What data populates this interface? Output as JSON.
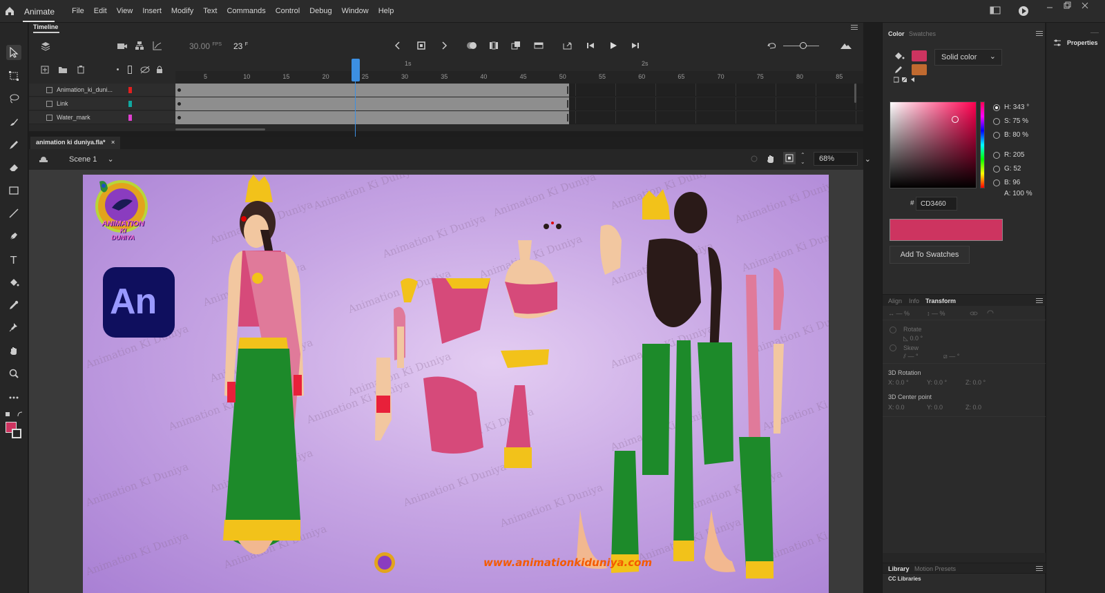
{
  "app": {
    "name": "Animate"
  },
  "menu": [
    "File",
    "Edit",
    "View",
    "Insert",
    "Modify",
    "Text",
    "Commands",
    "Control",
    "Debug",
    "Window",
    "Help"
  ],
  "timeline": {
    "panel_title": "Timeline",
    "fps": "30.00",
    "fps_unit": "FPS",
    "frame": "23",
    "frame_unit": "F",
    "ruler_numbers": [
      "5",
      "10",
      "15",
      "20",
      "25",
      "30",
      "35",
      "40",
      "45",
      "50",
      "55",
      "60",
      "65",
      "70",
      "75",
      "80",
      "85"
    ],
    "ruler_seconds": [
      "1s",
      "2s"
    ],
    "layers": [
      {
        "name": "Animation_ki_duni...",
        "color": "#e02020"
      },
      {
        "name": "Link",
        "color": "#10a8a0"
      },
      {
        "name": "Water_mark",
        "color": "#e040d0"
      }
    ]
  },
  "document": {
    "tab_title": "animation ki duniya.fla*",
    "scene": "Scene 1",
    "zoom": "68%"
  },
  "stage": {
    "logo_text": "An",
    "brand_logo_line1": "ANIMATION",
    "brand_logo_line2": "KI",
    "brand_logo_line3": "DUNIYA",
    "watermark": "Animation Ki Duniya",
    "url": "www.animationkiduniya.com"
  },
  "color_panel": {
    "tabs": [
      "Color",
      "Swatches"
    ],
    "fill_type": "Solid color",
    "stroke_color": "#CD3460",
    "fill_color": "#C06A30",
    "hsb": {
      "H_label": "H:",
      "H": "343 °",
      "S_label": "S:",
      "S": "75 %",
      "B_label": "B:",
      "B": "80 %"
    },
    "rgb": {
      "R_label": "R:",
      "R": "205",
      "G_label": "G:",
      "G": "52",
      "B_label": "B:",
      "B": "96"
    },
    "alpha_label": "A:",
    "alpha": "100 %",
    "hex_prefix": "#",
    "hex": "CD3460",
    "current_color": "#CD3460",
    "add_button": "Add To Swatches"
  },
  "transform_panel": {
    "tabs": [
      "Align",
      "Info",
      "Transform"
    ],
    "width_val": "— %",
    "height_val": "— %",
    "rotate_label": "Rotate",
    "rotate_val": "0.0 °",
    "skew_label": "Skew",
    "skew_val1": "— °",
    "skew_val2": "— °",
    "rot3d_label": "3D Rotation",
    "rot3d": {
      "x_label": "X:",
      "x": "0.0 °",
      "y_label": "Y:",
      "y": "0.0 °",
      "z_label": "Z:",
      "z": "0.0 °"
    },
    "center_label": "3D Center point",
    "center": {
      "x_label": "X:",
      "x": "0.0",
      "y_label": "Y:",
      "y": "0.0",
      "z_label": "Z:",
      "z": "0.0"
    }
  },
  "library_tabs": [
    "Library",
    "Motion Presets"
  ],
  "cc_libraries": "CC Libraries",
  "properties_label": "Properties",
  "tool_colors": {
    "stroke": "#CD3460"
  }
}
